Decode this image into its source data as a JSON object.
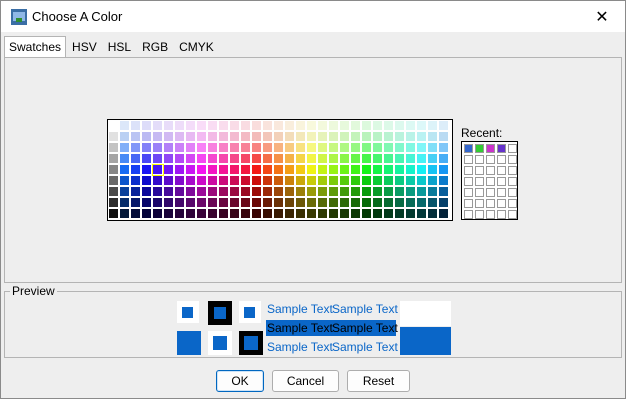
{
  "window": {
    "title": "Choose A Color"
  },
  "tabs": [
    "Swatches",
    "HSV",
    "HSL",
    "RGB",
    "CMYK"
  ],
  "swatches": {
    "recent_label": "Recent:",
    "recent_colors": [
      "#3366cc",
      "#33cc33",
      "#cc33cc",
      "#6633cc"
    ]
  },
  "preview": {
    "label": "Preview",
    "sample_text": "Sample Text",
    "color": "#0a66c8"
  },
  "buttons": {
    "ok": "OK",
    "cancel": "Cancel",
    "reset": "Reset"
  }
}
